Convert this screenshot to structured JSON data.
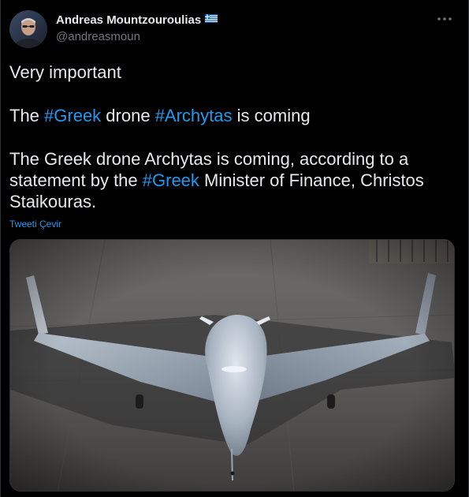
{
  "author": {
    "display_name": "Andreas Mountzouroulias",
    "flag": "🇬🇷",
    "handle": "@andreasmoun"
  },
  "tweet": {
    "line1": "Very important",
    "line2_pre": "The ",
    "hashtag1": "#Greek",
    "line2_mid": " drone ",
    "hashtag2": "#Archytas",
    "line2_post": " is coming",
    "line3_pre": "The Greek drone Archytas is coming, according to a statement by the ",
    "hashtag3": "#Greek",
    "line3_post": " Minister of Finance, Christos Staikouras."
  },
  "translate_label": "Tweeti Çevir",
  "icons": {
    "more": "more-horizontal-icon",
    "flag": "greece-flag-icon"
  },
  "colors": {
    "background": "#000000",
    "text": "#e7e9ea",
    "secondary": "#71767b",
    "accent": "#1d9bf0"
  }
}
